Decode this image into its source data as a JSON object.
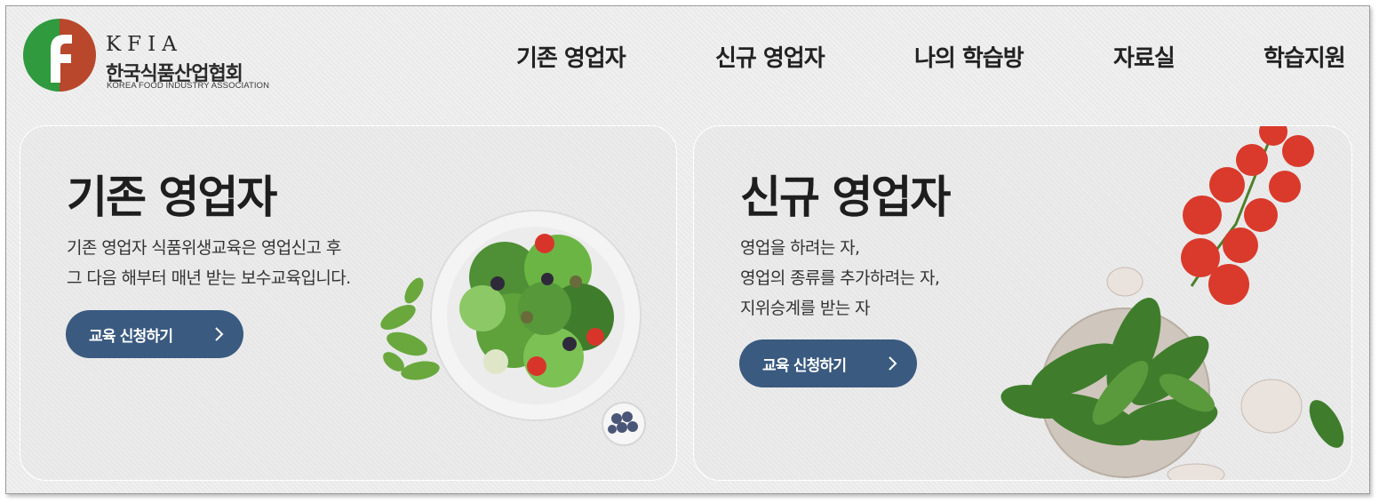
{
  "header": {
    "logo": {
      "abbr": "KFIA",
      "name_ko": "한국식품산업협회",
      "name_en": "KOREA FOOD INDUSTRY ASSOCIATION"
    },
    "nav": [
      {
        "label": "기존 영업자"
      },
      {
        "label": "신규 영업자"
      },
      {
        "label": "나의 학습방"
      },
      {
        "label": "자료실"
      },
      {
        "label": "학습지원"
      }
    ]
  },
  "cards": [
    {
      "title": "기존 영업자",
      "desc": [
        "기존 영업자 식품위생교육은 영업신고 후",
        "그 다음 해부터 매년 받는 보수교육입니다."
      ],
      "button_label": "교육 신청하기",
      "button_icon": "chevron-right-icon",
      "image": "salad-bowl"
    },
    {
      "title": "신규 영업자",
      "desc": [
        "영업을 하려는 자,",
        "영업의 종류를 추가하려는 자,",
        "지위승계를 받는 자"
      ],
      "button_label": "교육 신청하기",
      "button_icon": "chevron-right-icon",
      "image": "spinach-tomatoes-garlic"
    }
  ],
  "colors": {
    "button": "#3a5a80",
    "logo_green": "#2f9a3e",
    "logo_red": "#b8472c"
  }
}
